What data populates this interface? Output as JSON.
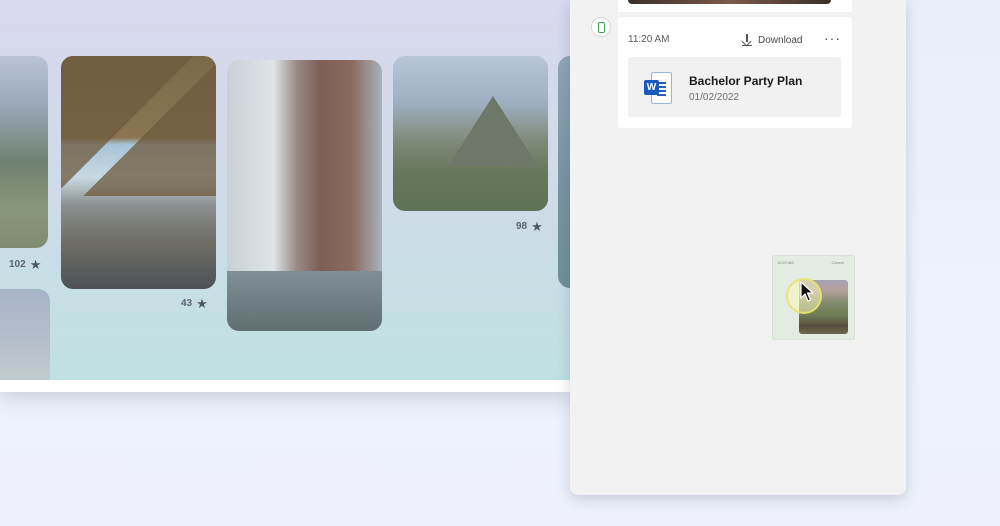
{
  "gallery": {
    "ratings": [
      {
        "value": "102"
      },
      {
        "value": "43"
      },
      {
        "value": "98"
      }
    ]
  },
  "panel": {
    "message": {
      "time": "11:20 AM",
      "download_label": "Download",
      "more_label": "···",
      "file": {
        "name": "Bachelor Party Plan",
        "date": "01/02/2022",
        "icon": "word-document-icon",
        "icon_letter": "W"
      }
    },
    "drag_preview": {
      "time": "11:20 AM",
      "cancel_label": "Cancel"
    }
  },
  "colors": {
    "accent_word": "#185abd",
    "phone_badge": "#3aa55a",
    "panel_bg": "#f2f2f2"
  }
}
